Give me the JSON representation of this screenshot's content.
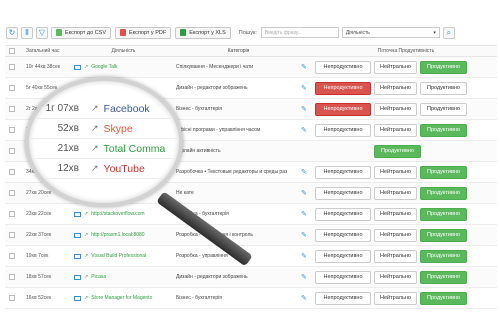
{
  "toolbar": {
    "csv_label": "Експорт до CSV",
    "pdf_label": "Експорт у PDF",
    "xls_label": "Експорт у XLS",
    "search_label": "Пошук:",
    "search_placeholder": "Введіть фразу...",
    "filter_value": "Діяльність"
  },
  "table": {
    "headers": {
      "time": "Загальний час",
      "activity": "Діяльність",
      "category": "Категорія",
      "productivity": "Поточна Продуктивність"
    },
    "buttons": {
      "unproductive": "Непродуктивно",
      "neutral": "Нейтрально",
      "productive": "Продуктивно"
    },
    "rows": [
      {
        "time": "10г 44хв 38сек",
        "name": "Google Talk",
        "category": "Спілкування - Месенджери і чати",
        "state": "productive",
        "full": true
      },
      {
        "time": "5г 40хв 55сек",
        "name": "",
        "category": "Дизайн - редактори зображень",
        "state": "unproductive",
        "full": true
      },
      {
        "time": "2г 2хв 37сек",
        "name": "",
        "category": "Бізнес - бухгалтерія",
        "state": "unproductive",
        "full": true
      },
      {
        "time": "1г 15хв 3",
        "name": "",
        "category": "Офісні програми - управління часом",
        "state": "productive",
        "full": true
      },
      {
        "time": "34хв 56сек",
        "name": "",
        "category": "Офлайн активність",
        "state": "productive",
        "full": false
      },
      {
        "time": "34хв 36сек",
        "name": "",
        "category": "Разробочка • Текстовые редакторы и среды раз",
        "state": "productive",
        "full": true
      },
      {
        "time": "27хв 20сек",
        "name": "http://localhost",
        "category": "Не кате",
        "state": "productive",
        "full": true
      },
      {
        "time": "23хв 22сек",
        "name": "http://stackoverflow.com",
        "category": "Розробка - бухгалтерія",
        "state": "productive",
        "full": true
      },
      {
        "time": "22хв 37сек",
        "name": "http://praxm1.local:8080",
        "category": "Розробка - тестування і контроль",
        "state": "productive",
        "full": true
      },
      {
        "time": "19хв 7сек",
        "name": "Visual Build Professional",
        "category": "Розробка - управління",
        "state": "productive",
        "full": true
      },
      {
        "time": "18хв 57сек",
        "name": "Picasa",
        "category": "Дизайн - редактори зображень",
        "state": "productive",
        "full": true
      },
      {
        "time": "16хв 52сек",
        "name": "Store Manager for Magento",
        "category": "Бізнес - бухгалтерія",
        "state": "productive",
        "full": true
      }
    ]
  },
  "magnifier": {
    "rows": [
      {
        "time": "1г 07хв",
        "name": "Facebook",
        "color": "#3b5998"
      },
      {
        "time": "52хв",
        "name": "Skype",
        "color": "#e4583a"
      },
      {
        "time": "21хв",
        "name": "Total Comma",
        "color": "#2e9e3e"
      },
      {
        "time": "12хв",
        "name": "YouTube",
        "color": "#cc3333"
      }
    ]
  },
  "colors": {
    "accent": "#3a8fc9",
    "productive": "#5cb85c",
    "unproductive": "#d9534f",
    "link": "#2e9e3e"
  }
}
